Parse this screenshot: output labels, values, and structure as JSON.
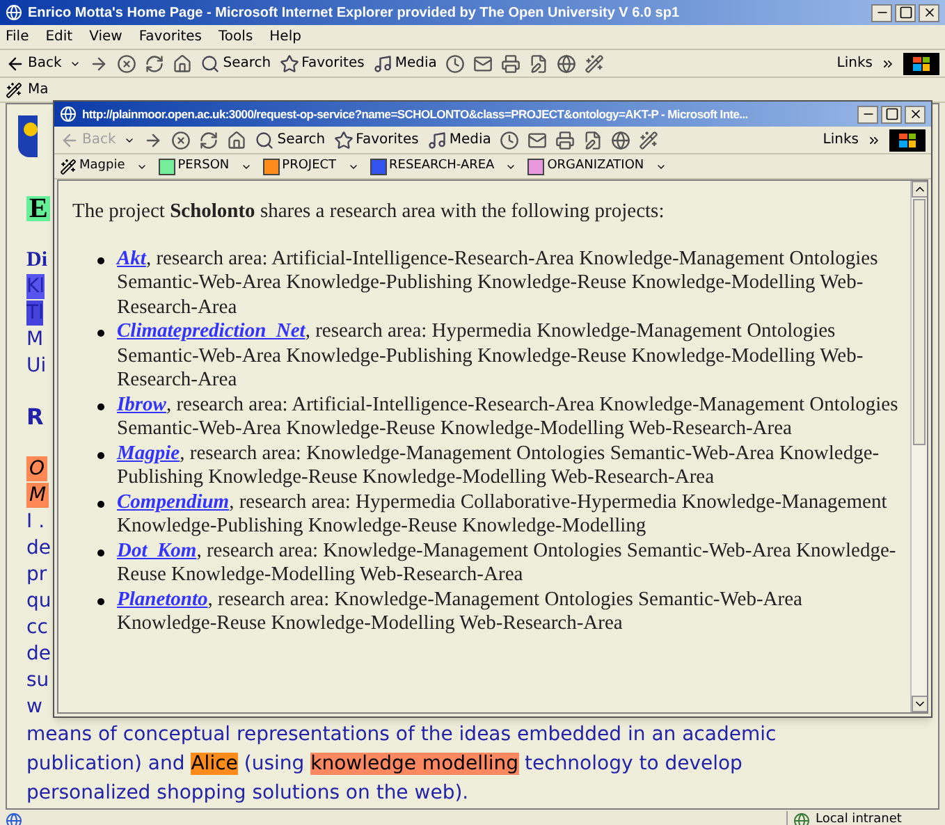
{
  "window": {
    "title": "Enrico Motta's Home Page - Microsoft Internet Explorer provided by The Open University V 6.0 sp1"
  },
  "menu": [
    "File",
    "Edit",
    "View",
    "Favorites",
    "Tools",
    "Help"
  ],
  "toolbar": {
    "back": {
      "label": "Back",
      "disabled": false
    },
    "buttons": [
      "Search",
      "Favorites",
      "Media"
    ],
    "links": "Links"
  },
  "links_bar": {
    "label": "Ma"
  },
  "page": {
    "fragments": [
      {
        "text": "E",
        "kind": "heading",
        "color": "#66ee99"
      },
      {
        "text": "Di",
        "kind": "serif"
      },
      {
        "text": "Kl",
        "kind": "text",
        "color": "#5555ee"
      },
      {
        "text": "Tl",
        "kind": "text",
        "color": "#4444dd"
      },
      {
        "text": "M",
        "kind": "text"
      },
      {
        "text": "Ui",
        "kind": "text"
      },
      {
        "text": "R",
        "kind": "bold"
      },
      {
        "text": "O",
        "kind": "italic",
        "color": "#ff8855"
      },
      {
        "text": "M",
        "kind": "italic",
        "color": "#ff8855"
      },
      {
        "text": "I .",
        "kind": "text"
      },
      {
        "text": "de",
        "kind": "text"
      },
      {
        "text": "pr",
        "kind": "text"
      },
      {
        "text": "qu",
        "kind": "text"
      },
      {
        "text": "cc",
        "kind": "text"
      },
      {
        "text": "de",
        "kind": "text"
      },
      {
        "text": "su",
        "kind": "text"
      },
      {
        "text": "w",
        "kind": "text"
      }
    ],
    "paragraph": [
      {
        "text": "means of conceptual representations of the ideas embedded in an academic publication) and "
      },
      {
        "text": "Alice",
        "color": "#ff8c1a"
      },
      {
        "text": " (using "
      },
      {
        "text": "knowledge modelling",
        "color": "#ff8860"
      },
      {
        "text": " technology to develop personalized shopping solutions on the web)."
      }
    ]
  },
  "status_bar": {
    "zone": "Local intranet"
  },
  "popup": {
    "title": "http://plainmoor.open.ac.uk:3000/request-op-service?name=SCHOLONTO&class=PROJECT&ontology=AKT-P - Microsoft Inte...",
    "toolbar": {
      "back": {
        "label": "Back",
        "disabled": true
      },
      "buttons": [
        "Search",
        "Favorites",
        "Media"
      ],
      "links": "Links"
    },
    "magpie": {
      "label": "Magpie",
      "categories": [
        {
          "label": "PERSON",
          "color": "#77ee99"
        },
        {
          "label": "PROJECT",
          "color": "#ff8c1a"
        },
        {
          "label": "RESEARCH-AREA",
          "color": "#3355ee"
        },
        {
          "label": "ORGANIZATION",
          "color": "#e699dd"
        }
      ]
    },
    "intro": "The project **Scholonto** shares a research area with the following projects:",
    "projects": [
      {
        "name": "Akt",
        "text": ", research area: Artificial-Intelligence-Research-Area Knowledge-Management Ontologies Semantic-Web-Area Knowledge-Publishing Knowledge-Reuse Knowledge-Modelling Web-Research-Area"
      },
      {
        "name": "Climateprediction_Net",
        "text": ", research area: Hypermedia Knowledge-Management Ontologies Semantic-Web-Area Knowledge-Publishing Knowledge-Reuse Knowledge-Modelling Web-Research-Area"
      },
      {
        "name": "Ibrow",
        "text": ", research area: Artificial-Intelligence-Research-Area Knowledge-Management Ontologies Semantic-Web-Area Knowledge-Reuse Knowledge-Modelling Web-Research-Area"
      },
      {
        "name": "Magpie",
        "text": ", research area: Knowledge-Management Ontologies Semantic-Web-Area Knowledge-Publishing Knowledge-Reuse Knowledge-Modelling Web-Research-Area"
      },
      {
        "name": "Compendium",
        "text": ", research area: Hypermedia Collaborative-Hypermedia Knowledge-Management Knowledge-Publishing Knowledge-Reuse Knowledge-Modelling"
      },
      {
        "name": "Dot_Kom",
        "text": ", research area: Knowledge-Management Ontologies Semantic-Web-Area Knowledge-Reuse Knowledge-Modelling Web-Research-Area"
      },
      {
        "name": "Planetonto",
        "text": ", research area: Knowledge-Management Ontologies Semantic-Web-Area Knowledge-Reuse Knowledge-Modelling Web-Research-Area"
      }
    ]
  }
}
